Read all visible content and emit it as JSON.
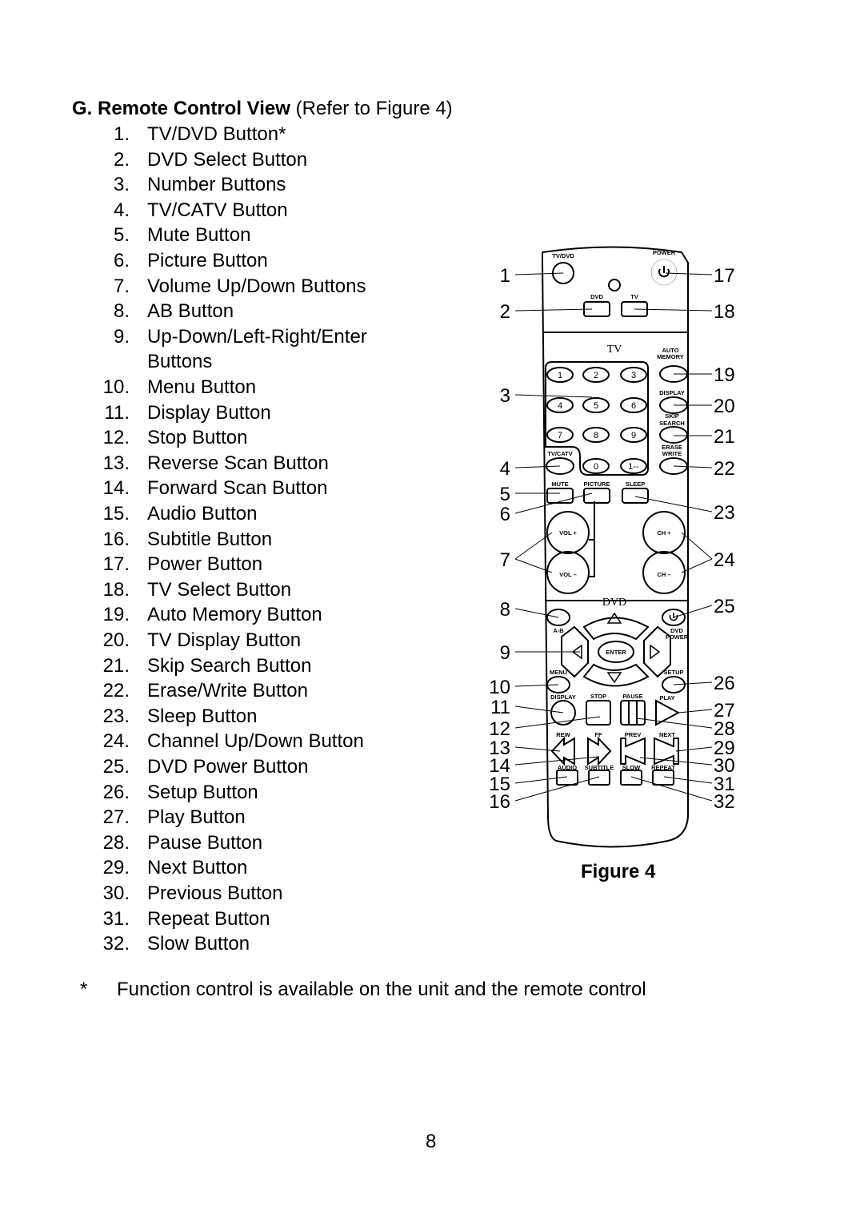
{
  "section": {
    "title_bold": "G. Remote Control View",
    "title_rest": " (Refer to Figure 4)"
  },
  "items": [
    {
      "num": "1.",
      "label": "TV/DVD Button*"
    },
    {
      "num": "2.",
      "label": "DVD Select Button"
    },
    {
      "num": "3.",
      "label": "Number Buttons"
    },
    {
      "num": "4.",
      "label": "TV/CATV Button"
    },
    {
      "num": "5.",
      "label": "Mute Button"
    },
    {
      "num": "6.",
      "label": "Picture Button"
    },
    {
      "num": "7.",
      "label": "Volume Up/Down Buttons"
    },
    {
      "num": "8.",
      "label": "AB Button"
    },
    {
      "num": "9.",
      "label": "Up-Down/Left-Right/Enter"
    },
    {
      "num": "",
      "label": "Buttons"
    },
    {
      "num": "10.",
      "label": "Menu Button"
    },
    {
      "num": "11.",
      "label": "Display Button"
    },
    {
      "num": "12.",
      "label": "Stop Button"
    },
    {
      "num": "13.",
      "label": "Reverse Scan Button"
    },
    {
      "num": "14.",
      "label": "Forward Scan Button"
    },
    {
      "num": "15.",
      "label": "Audio Button"
    },
    {
      "num": "16.",
      "label": "Subtitle Button"
    },
    {
      "num": "17.",
      "label": "Power Button"
    },
    {
      "num": "18.",
      "label": "TV Select Button"
    },
    {
      "num": "19.",
      "label": "Auto Memory Button"
    },
    {
      "num": "20.",
      "label": "TV Display Button"
    },
    {
      "num": "21.",
      "label": "Skip Search Button"
    },
    {
      "num": "22.",
      "label": "Erase/Write Button"
    },
    {
      "num": "23.",
      "label": "Sleep Button"
    },
    {
      "num": "24.",
      "label": "Channel Up/Down Button"
    },
    {
      "num": "25.",
      "label": "DVD Power Button"
    },
    {
      "num": "26.",
      "label": "Setup Button"
    },
    {
      "num": "27.",
      "label": "Play Button"
    },
    {
      "num": "28.",
      "label": "Pause Button"
    },
    {
      "num": "29.",
      "label": "Next Button"
    },
    {
      "num": "30.",
      "label": "Previous Button"
    },
    {
      "num": "31.",
      "label": "Repeat Button"
    },
    {
      "num": "32.",
      "label": "Slow Button"
    }
  ],
  "footnote": {
    "marker": "*",
    "text": "Function control is available on the unit and the remote control"
  },
  "figure": {
    "caption": "Figure 4",
    "remote_labels": {
      "tvdvd": "TV/DVD",
      "power": "POWER",
      "dvd": "DVD",
      "tv": "TV",
      "tv_section": "TV",
      "auto_memory_1": "AUTO",
      "auto_memory_2": "MEMORY",
      "display": "DISPLAY",
      "skip_1": "SKIP",
      "skip_2": "SEARCH",
      "erase_1": "ERASE",
      "erase_2": "WRITE",
      "tvcatv": "TV/CATV",
      "mute": "MUTE",
      "picture": "PICTURE",
      "sleep": "SLEEP",
      "vol_up": "VOL +",
      "vol_down": "VOL –",
      "ch_up": "CH +",
      "ch_down": "CH –",
      "dvd_section": "DVD",
      "ab": "A-B",
      "dvd_power_1": "DVD",
      "dvd_power_2": "POWER",
      "enter": "ENTER",
      "menu": "MENU",
      "setup": "SETUP",
      "display2": "DISPLAY",
      "stop": "STOP",
      "pause": "PAUSE",
      "play": "PLAY",
      "rew": "REW",
      "ff": "FF",
      "prev": "PREV",
      "next": "NEXT",
      "audio": "AUDIO",
      "subtitle": "SUBTITLE",
      "slow": "SLOW",
      "repeat": "REPEAT",
      "keys": [
        "1",
        "2",
        "3",
        "4",
        "5",
        "6",
        "7",
        "8",
        "9",
        "0",
        "1--"
      ]
    },
    "callouts_left": [
      "1",
      "2",
      "3",
      "4",
      "5",
      "6",
      "7",
      "8",
      "9",
      "10",
      "11",
      "12",
      "13",
      "14",
      "15",
      "16"
    ],
    "callouts_right": [
      "17",
      "18",
      "19",
      "20",
      "21",
      "22",
      "23",
      "24",
      "25",
      "26",
      "27",
      "28",
      "29",
      "30",
      "31",
      "32"
    ]
  },
  "page_number": "8"
}
